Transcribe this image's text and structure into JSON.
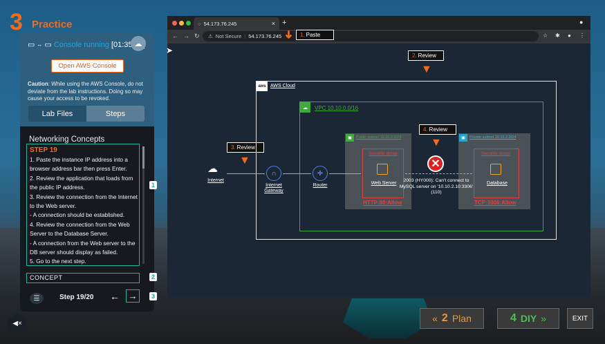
{
  "logo": {
    "number": "3",
    "title": "Practice"
  },
  "panel": {
    "console_status": "Console running",
    "timer": "[01:35:28]",
    "open_console_label": "Open AWS Console",
    "caution_label": "Caution",
    "caution_text": ": While using the AWS Console, do not deviate from the lab instructions. Doing so may cause your access to be revoked.",
    "tabs": [
      {
        "label": "Lab Files"
      },
      {
        "label": "Steps"
      }
    ],
    "section_title": "Networking Concepts",
    "step_heading": "STEP 19",
    "step_lines": [
      "1.  Paste the instance IP address into a browser address bar then press Enter.",
      "2.  Review the application that loads from the public IP address.",
      "3.  Review the connection from the Internet to the Web server.",
      "- A connection should be established.",
      "4.  Review the connection from the Web Server to the Database Server.",
      "- A connection from the Web server to the DB server should display as failed.",
      "5.  Go to the next step."
    ],
    "concept_label": "CONCEPT",
    "step_counter": "Step 19/20",
    "markers": [
      "1",
      "2",
      "3"
    ]
  },
  "browser": {
    "tab_title": "54.173.76.245",
    "not_secure": "Not Secure",
    "url": "54.173.76.245"
  },
  "callouts": [
    {
      "num": "1.",
      "text": "Paste"
    },
    {
      "num": "2.",
      "text": "Review"
    },
    {
      "num": "3.",
      "text": "Review"
    },
    {
      "num": "4.",
      "text": "Review"
    }
  ],
  "diagram": {
    "aws_badge": "aws",
    "aws_label": "AWS Cloud",
    "vpc_label": "VPC 10.10.0.0/16",
    "public_subnet": "Public subnet 10.10.0.0/24",
    "private_subnet": "Private subnet 10.10.2.0/24",
    "security_group": "Security group",
    "internet": "Internet",
    "internet_gateway": "Internet Gateway",
    "router": "Router",
    "web_server": "Web Server",
    "database": "Database",
    "http_rule": "HTTP:80:Allow",
    "tcp_rule": "TCP:3306:Allow",
    "error_text": "2003 (HY000): Can't connect to MySQL server on '10.10.2.10:3306' (110)"
  },
  "footer": {
    "plan_num": "2",
    "plan_label": "Plan",
    "diy_num": "4",
    "diy_label": "DIY",
    "exit_label": "EXIT"
  },
  "colors": {
    "accent": "#f36b1c",
    "teal": "#1fb59a",
    "green": "#3eaa3e",
    "red": "#e04040"
  }
}
